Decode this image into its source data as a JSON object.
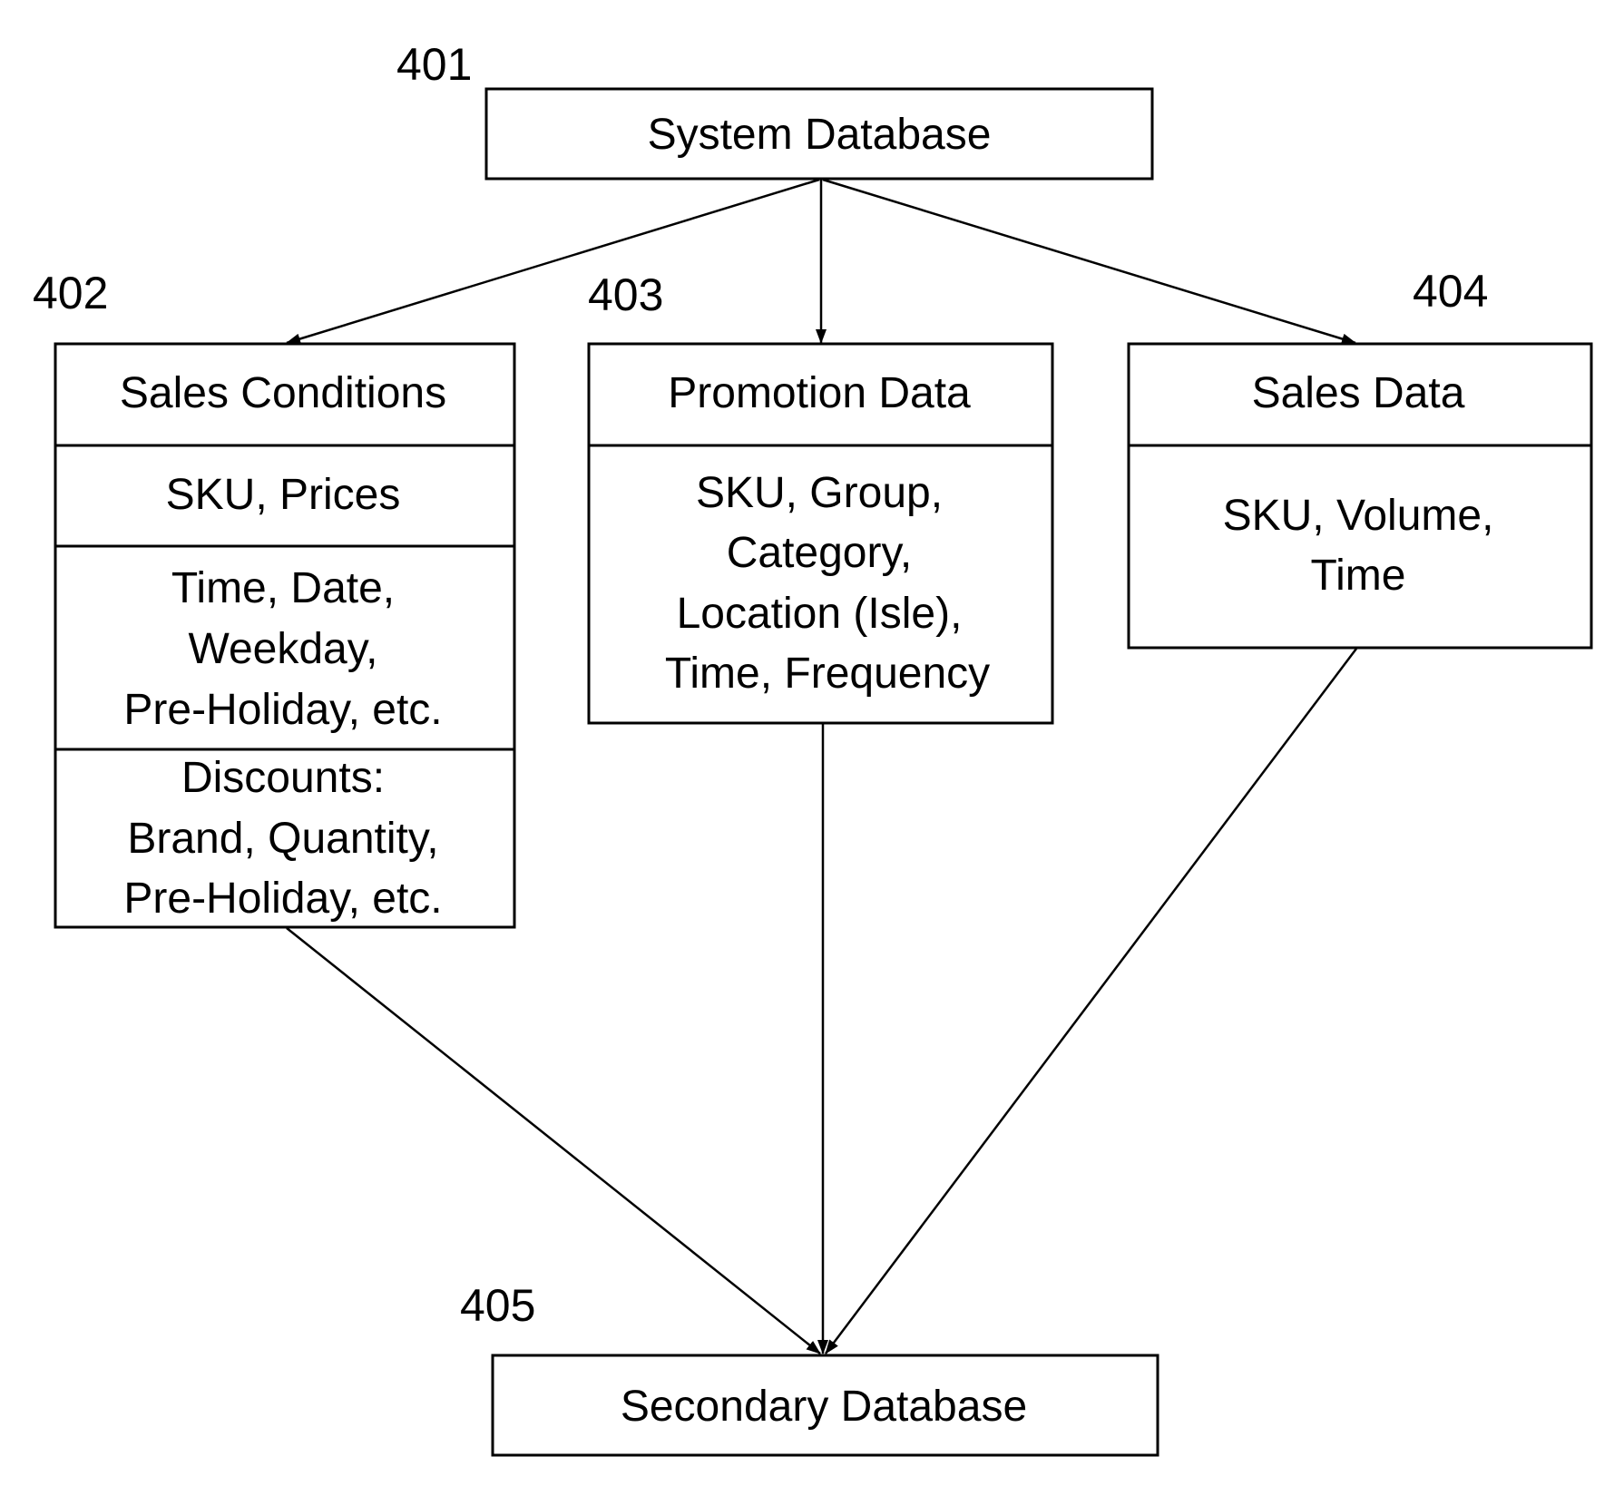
{
  "diagram": {
    "type": "flow",
    "nodes": [
      {
        "id": "401",
        "ref": "401",
        "title": "System Database",
        "sections": []
      },
      {
        "id": "402",
        "ref": "402",
        "title": "Sales Conditions",
        "sections": [
          [
            "SKU, Prices"
          ],
          [
            "Time, Date,",
            "Weekday,",
            "Pre-Holiday, etc."
          ],
          [
            "Discounts:",
            "Brand, Quantity,",
            "Pre-Holiday, etc."
          ]
        ]
      },
      {
        "id": "403",
        "ref": "403",
        "title": "Promotion Data",
        "sections": [
          [
            "SKU, Group,",
            "Category,",
            "Location (Isle),",
            "Time, Frequency"
          ]
        ]
      },
      {
        "id": "404",
        "ref": "404",
        "title": "Sales Data",
        "sections": [
          [
            "SKU, Volume,",
            "Time"
          ]
        ]
      },
      {
        "id": "405",
        "ref": "405",
        "title": "Secondary Database",
        "sections": []
      }
    ],
    "edges": [
      {
        "from": "401",
        "to": "402",
        "arrow": true
      },
      {
        "from": "401",
        "to": "403",
        "arrow": true
      },
      {
        "from": "401",
        "to": "404",
        "arrow": true
      },
      {
        "from": "402",
        "to": "405",
        "arrow": true
      },
      {
        "from": "403",
        "to": "405",
        "arrow": true
      },
      {
        "from": "404",
        "to": "405",
        "arrow": true
      }
    ],
    "colors": {
      "line": "#000000",
      "background": "#ffffff"
    }
  }
}
